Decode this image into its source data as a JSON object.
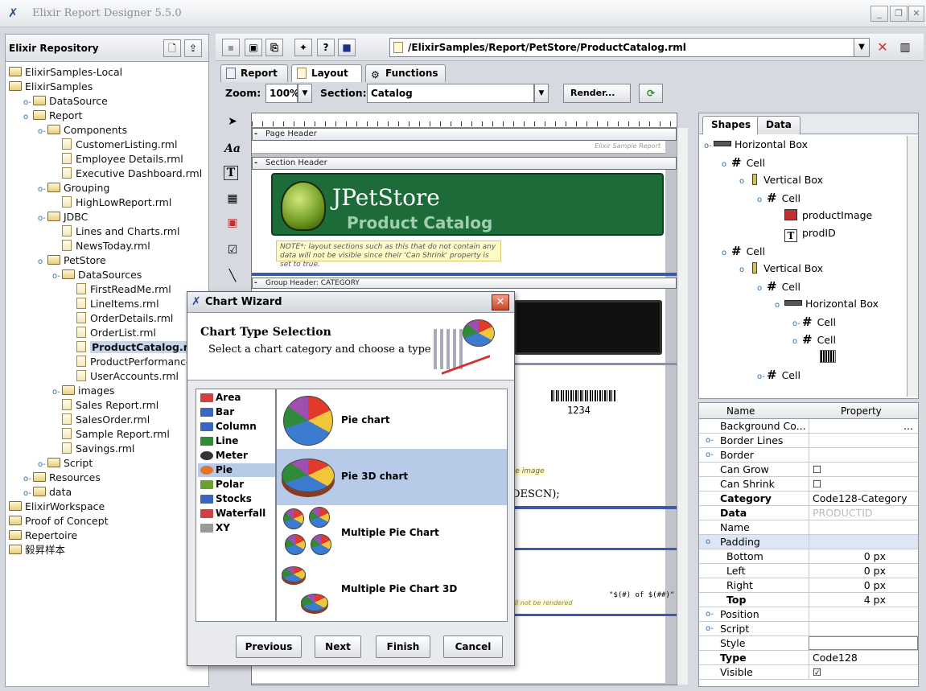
{
  "window": {
    "title": "Elixir Report Designer 5.5.0",
    "minimize": "_",
    "restore": "❐",
    "close": "✕"
  },
  "repository": {
    "title": "Elixir Repository",
    "new_label": "🗋",
    "add_label": "⇪",
    "tree": [
      {
        "label": "ElixirSamples-Local",
        "depth": 0,
        "kind": "folder",
        "exp": ""
      },
      {
        "label": "ElixirSamples",
        "depth": 0,
        "kind": "folder",
        "exp": ""
      },
      {
        "label": "DataSource",
        "depth": 1,
        "kind": "folder",
        "exp": "o-"
      },
      {
        "label": "Report",
        "depth": 1,
        "kind": "folder",
        "exp": "o"
      },
      {
        "label": "Components",
        "depth": 2,
        "kind": "folder",
        "exp": "o-"
      },
      {
        "label": "CustomerListing.rml",
        "depth": 3,
        "kind": "file",
        "exp": ""
      },
      {
        "label": "Employee Details.rml",
        "depth": 3,
        "kind": "file",
        "exp": ""
      },
      {
        "label": "Executive Dashboard.rml",
        "depth": 3,
        "kind": "file",
        "exp": ""
      },
      {
        "label": "Grouping",
        "depth": 2,
        "kind": "folder",
        "exp": "o-"
      },
      {
        "label": "HighLowReport.rml",
        "depth": 3,
        "kind": "file",
        "exp": ""
      },
      {
        "label": "JDBC",
        "depth": 2,
        "kind": "folder",
        "exp": "o-"
      },
      {
        "label": "Lines and Charts.rml",
        "depth": 3,
        "kind": "file",
        "exp": ""
      },
      {
        "label": "NewsToday.rml",
        "depth": 3,
        "kind": "file",
        "exp": ""
      },
      {
        "label": "PetStore",
        "depth": 2,
        "kind": "folder",
        "exp": "o"
      },
      {
        "label": "DataSources",
        "depth": 3,
        "kind": "folder",
        "exp": "o-"
      },
      {
        "label": "FirstReadMe.rml",
        "depth": 4,
        "kind": "file",
        "exp": ""
      },
      {
        "label": "LineItems.rml",
        "depth": 4,
        "kind": "file",
        "exp": ""
      },
      {
        "label": "OrderDetails.rml",
        "depth": 4,
        "kind": "file",
        "exp": ""
      },
      {
        "label": "OrderList.rml",
        "depth": 4,
        "kind": "file",
        "exp": ""
      },
      {
        "label": "ProductCatalog.rml",
        "depth": 4,
        "kind": "file",
        "exp": "",
        "selected": true
      },
      {
        "label": "ProductPerformance",
        "depth": 4,
        "kind": "file",
        "exp": ""
      },
      {
        "label": "UserAccounts.rml",
        "depth": 4,
        "kind": "file",
        "exp": ""
      },
      {
        "label": "images",
        "depth": 3,
        "kind": "folder",
        "exp": "o-"
      },
      {
        "label": "Sales Report.rml",
        "depth": 3,
        "kind": "file",
        "exp": ""
      },
      {
        "label": "SalesOrder.rml",
        "depth": 3,
        "kind": "file",
        "exp": ""
      },
      {
        "label": "Sample Report.rml",
        "depth": 3,
        "kind": "file",
        "exp": ""
      },
      {
        "label": "Savings.rml",
        "depth": 3,
        "kind": "file",
        "exp": ""
      },
      {
        "label": "Script",
        "depth": 2,
        "kind": "folder",
        "exp": "o-"
      },
      {
        "label": "Resources",
        "depth": 1,
        "kind": "folder",
        "exp": "o-"
      },
      {
        "label": "data",
        "depth": 1,
        "kind": "folder",
        "exp": "o-"
      },
      {
        "label": "ElixirWorkspace",
        "depth": 0,
        "kind": "folder",
        "exp": ""
      },
      {
        "label": "Proof of Concept",
        "depth": 0,
        "kind": "folder",
        "exp": ""
      },
      {
        "label": "Repertoire",
        "depth": 0,
        "kind": "folder",
        "exp": ""
      },
      {
        "label": "毅昇样本",
        "depth": 0,
        "kind": "folder",
        "exp": ""
      }
    ]
  },
  "toolbar": {
    "help_label": "?",
    "path": "/ElixirSamples/Report/PetStore/ProductCatalog.rml"
  },
  "tabs": [
    {
      "label": "Report"
    },
    {
      "label": "Layout"
    },
    {
      "label": "Functions"
    }
  ],
  "zoombar": {
    "zoom_label": "Zoom:",
    "zoom_value": "100%",
    "section_label": "Section:",
    "section_value": "Catalog",
    "render_label": "Render..."
  },
  "canvas": {
    "page_header": "Page Header",
    "watermark": "Elixir Sample Report",
    "section_header": "Section Header",
    "jpet_title": "JPetStore",
    "jpet_subtitle": "Product Catalog",
    "note": "NOTE*: layout sections such as this that do not contain any data will not be visible since their 'Can Shrink' property is set to true.",
    "group_header": "Group Header: CATEGORY",
    "barcode_text": "1234",
    "func_text": "(DESCN);",
    "image_hint": "the image",
    "page_format": "\"$(#) of $(##)\"",
    "render_hint": "will not be rendered"
  },
  "shapes": {
    "tab_shapes": "Shapes",
    "tab_data": "Data",
    "nodes": [
      {
        "label": "Horizontal Box",
        "depth": 0,
        "kind": "hbox",
        "key": "o-"
      },
      {
        "label": "Cell",
        "depth": 1,
        "kind": "cell",
        "key": "o"
      },
      {
        "label": "Vertical Box",
        "depth": 2,
        "kind": "vbox",
        "key": "o"
      },
      {
        "label": "Cell",
        "depth": 3,
        "kind": "cell",
        "key": "o"
      },
      {
        "label": "productImage",
        "depth": 4,
        "kind": "img",
        "key": ""
      },
      {
        "label": "prodID",
        "depth": 4,
        "kind": "text",
        "key": ""
      },
      {
        "label": "Cell",
        "depth": 1,
        "kind": "cell",
        "key": "o"
      },
      {
        "label": "Vertical Box",
        "depth": 2,
        "kind": "vbox",
        "key": "o"
      },
      {
        "label": "Cell",
        "depth": 3,
        "kind": "cell",
        "key": "o"
      },
      {
        "label": "Horizontal Box",
        "depth": 4,
        "kind": "hbox",
        "key": "o"
      },
      {
        "label": "Cell",
        "depth": 5,
        "kind": "cell",
        "key": "o-"
      },
      {
        "label": "Cell",
        "depth": 5,
        "kind": "cell",
        "key": "o"
      },
      {
        "label": "",
        "depth": 6,
        "kind": "barcode",
        "key": ""
      },
      {
        "label": "Cell",
        "depth": 3,
        "kind": "cell",
        "key": "o-"
      }
    ]
  },
  "properties": {
    "col_name": "Name",
    "col_property": "Property",
    "rows": [
      {
        "name": "Background Co...",
        "value": "...",
        "exp": "",
        "bold": false
      },
      {
        "name": "Border Lines",
        "value": "",
        "exp": "o-",
        "bold": false
      },
      {
        "name": "Border",
        "value": "",
        "exp": "o-",
        "bold": false
      },
      {
        "name": "Can Grow",
        "value": "☐",
        "exp": "",
        "bold": false
      },
      {
        "name": "Can Shrink",
        "value": "☐",
        "exp": "",
        "bold": false
      },
      {
        "name": "Category",
        "value": "Code128-Category",
        "exp": "",
        "bold": true
      },
      {
        "name": "Data",
        "value": "PRODUCTID",
        "exp": "",
        "bold": true
      },
      {
        "name": "Name",
        "value": "",
        "exp": "",
        "bold": false
      },
      {
        "name": "Padding",
        "value": "",
        "exp": "o",
        "bold": false,
        "group": true
      },
      {
        "name": "Bottom",
        "value": "0 px",
        "exp": "",
        "bold": false
      },
      {
        "name": "Left",
        "value": "0 px",
        "exp": "",
        "bold": false
      },
      {
        "name": "Right",
        "value": "0 px",
        "exp": "",
        "bold": false
      },
      {
        "name": "Top",
        "value": "4 px",
        "exp": "",
        "bold": true
      },
      {
        "name": "Position",
        "value": "",
        "exp": "o-",
        "bold": false
      },
      {
        "name": "Script",
        "value": "",
        "exp": "o-",
        "bold": false
      },
      {
        "name": "Style",
        "value": "",
        "exp": "",
        "bold": false
      },
      {
        "name": "Type",
        "value": "Code128",
        "exp": "",
        "bold": true
      },
      {
        "name": "Visible",
        "value": "☑",
        "exp": "",
        "bold": false
      }
    ]
  },
  "dialog": {
    "title": "Chart Wizard",
    "heading": "Chart Type Selection",
    "subheading": "Select a chart category and choose a type",
    "categories": [
      {
        "label": "Area",
        "color": "#d04040"
      },
      {
        "label": "Bar",
        "color": "#3a66c0"
      },
      {
        "label": "Column",
        "color": "#3a66c0"
      },
      {
        "label": "Line",
        "color": "#2f8a3a"
      },
      {
        "label": "Meter",
        "color": "#333333"
      },
      {
        "label": "Pie",
        "color": "#e0762a",
        "selected": true
      },
      {
        "label": "Polar",
        "color": "#6aa030"
      },
      {
        "label": "Stocks",
        "color": "#3a66c0"
      },
      {
        "label": "Waterfall",
        "color": "#d04040"
      },
      {
        "label": "XY",
        "color": "#999999"
      }
    ],
    "types": [
      {
        "label": "Pie chart"
      },
      {
        "label": "Pie 3D chart",
        "selected": true
      },
      {
        "label": "Multiple Pie Chart"
      },
      {
        "label": "Multiple Pie Chart 3D"
      }
    ],
    "btn_previous": "Previous",
    "btn_next": "Next",
    "btn_finish": "Finish",
    "btn_cancel": "Cancel"
  }
}
